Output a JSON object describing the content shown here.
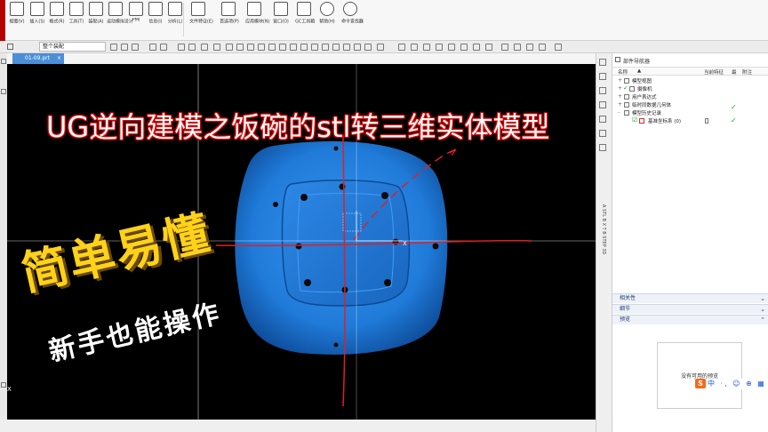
{
  "ribbon": {
    "items": [
      {
        "label": "视图(V)",
        "icon": "binoculars-icon"
      },
      {
        "label": "插入(S)",
        "icon": "insert-icon"
      },
      {
        "label": "格式(R)",
        "icon": "format-icon"
      },
      {
        "label": "工具(T)",
        "icon": "wrench-icon"
      },
      {
        "label": "装配(A)",
        "icon": "assembly-icon"
      },
      {
        "label": "运动模拟设计",
        "icon": "motion-icon"
      },
      {
        "label": "PMI",
        "icon": "snowflake-icon"
      },
      {
        "label": "信息(I)",
        "icon": "info-panel-icon"
      },
      {
        "label": "分析(L)",
        "icon": "info-icon"
      },
      {
        "label": "文件特征(E)",
        "icon": "feature-icon"
      },
      {
        "label": "首选项(P)",
        "icon": "preferences-icon"
      },
      {
        "label": "应用模块(N)",
        "icon": "application-icon"
      },
      {
        "label": "窗口(O)",
        "icon": "window-icon"
      },
      {
        "label": "GC工具箱",
        "icon": "gc-toolbox-icon"
      },
      {
        "label": "帮助(H)",
        "icon": "help-icon"
      },
      {
        "label": "命令查找器",
        "icon": "command-finder-icon"
      }
    ]
  },
  "toolbar": {
    "filter_select": "整个装配"
  },
  "viewport": {
    "tab_label": "01-09.prt",
    "tab_close": "×",
    "axis_label": "X"
  },
  "overlay": {
    "title": "UG逆向建模之饭碗的stl转三维实体模型",
    "promo_big": "简单易懂",
    "promo_small": "新手也能操作"
  },
  "resource_bar": {
    "vertical_text": "A STL B X T B STEP 3D"
  },
  "navigator": {
    "title": "部件导航器",
    "columns": {
      "name": "名称",
      "sort": "▲",
      "current": "当前特征",
      "latest": "最",
      "note": "附注"
    },
    "tree": [
      {
        "label": "模型视图",
        "exp": "+"
      },
      {
        "label": "摄像机",
        "exp": "+"
      },
      {
        "label": "用户表达式",
        "exp": "+"
      },
      {
        "label": "临时同数据几何体",
        "exp": "+"
      },
      {
        "label": "模型历史记录",
        "exp": "-"
      },
      {
        "label": "基准坐标系 (0)",
        "exp": ""
      }
    ],
    "sections": {
      "related": "相关性",
      "details": "细节",
      "preview": "预览"
    },
    "preview_message": "没有可用的预览"
  },
  "ime": {
    "logo": "S",
    "text": "中 ·, ☺ ⊕ ▦ ♥ ▦"
  },
  "colors": {
    "model_blue": "#1f7ad8",
    "axis_red": "#e02020",
    "promo_yellow": "#ffd21a",
    "title_outline": "#e00000",
    "tab_blue": "#4a8fd8"
  }
}
